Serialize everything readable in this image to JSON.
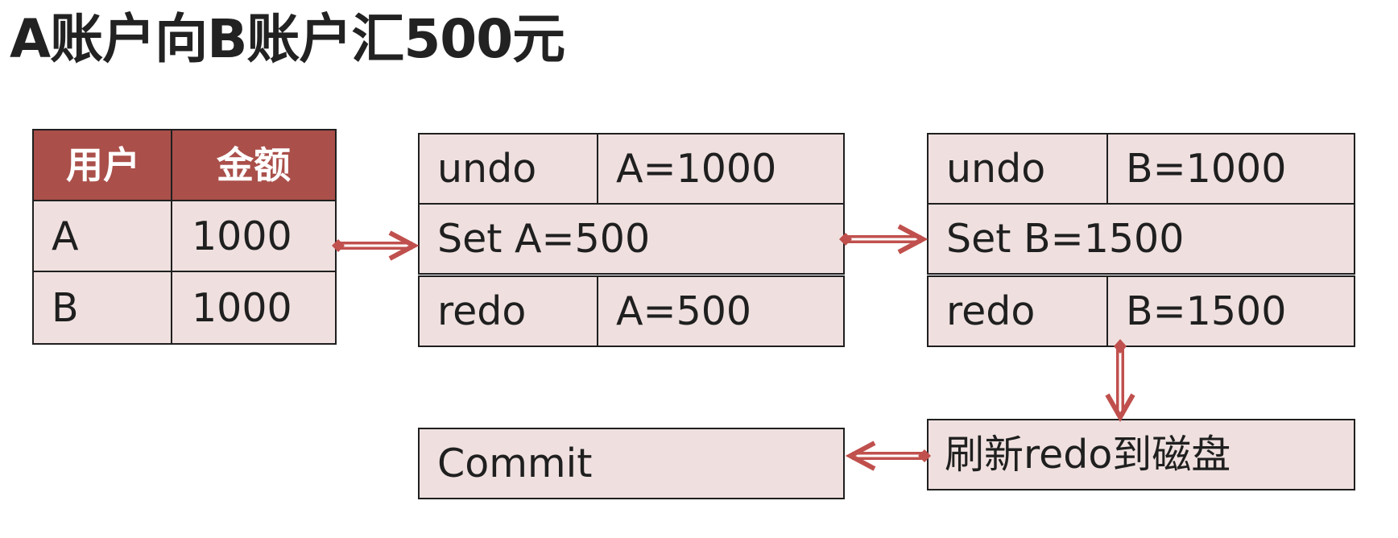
{
  "title": "A账户向B账户汇500元",
  "user_table": {
    "headers": [
      "用户",
      "金额"
    ],
    "rows": [
      [
        "A",
        "1000"
      ],
      [
        "B",
        "1000"
      ]
    ]
  },
  "tx_a": {
    "undo_label": "undo",
    "undo_value": "A=1000",
    "set_label": "Set A=500",
    "redo_label": "redo",
    "redo_value": "A=500"
  },
  "tx_b": {
    "undo_label": "undo",
    "undo_value": "B=1000",
    "set_label": "Set B=1500",
    "redo_label": "redo",
    "redo_value": "B=1500"
  },
  "flush_label": "刷新redo到磁盘",
  "commit_label": "Commit",
  "colors": {
    "box_fill": "#efe0df",
    "header_fill": "#aa4f4a",
    "arrow": "#c0504d",
    "border": "#1f1f1f"
  }
}
